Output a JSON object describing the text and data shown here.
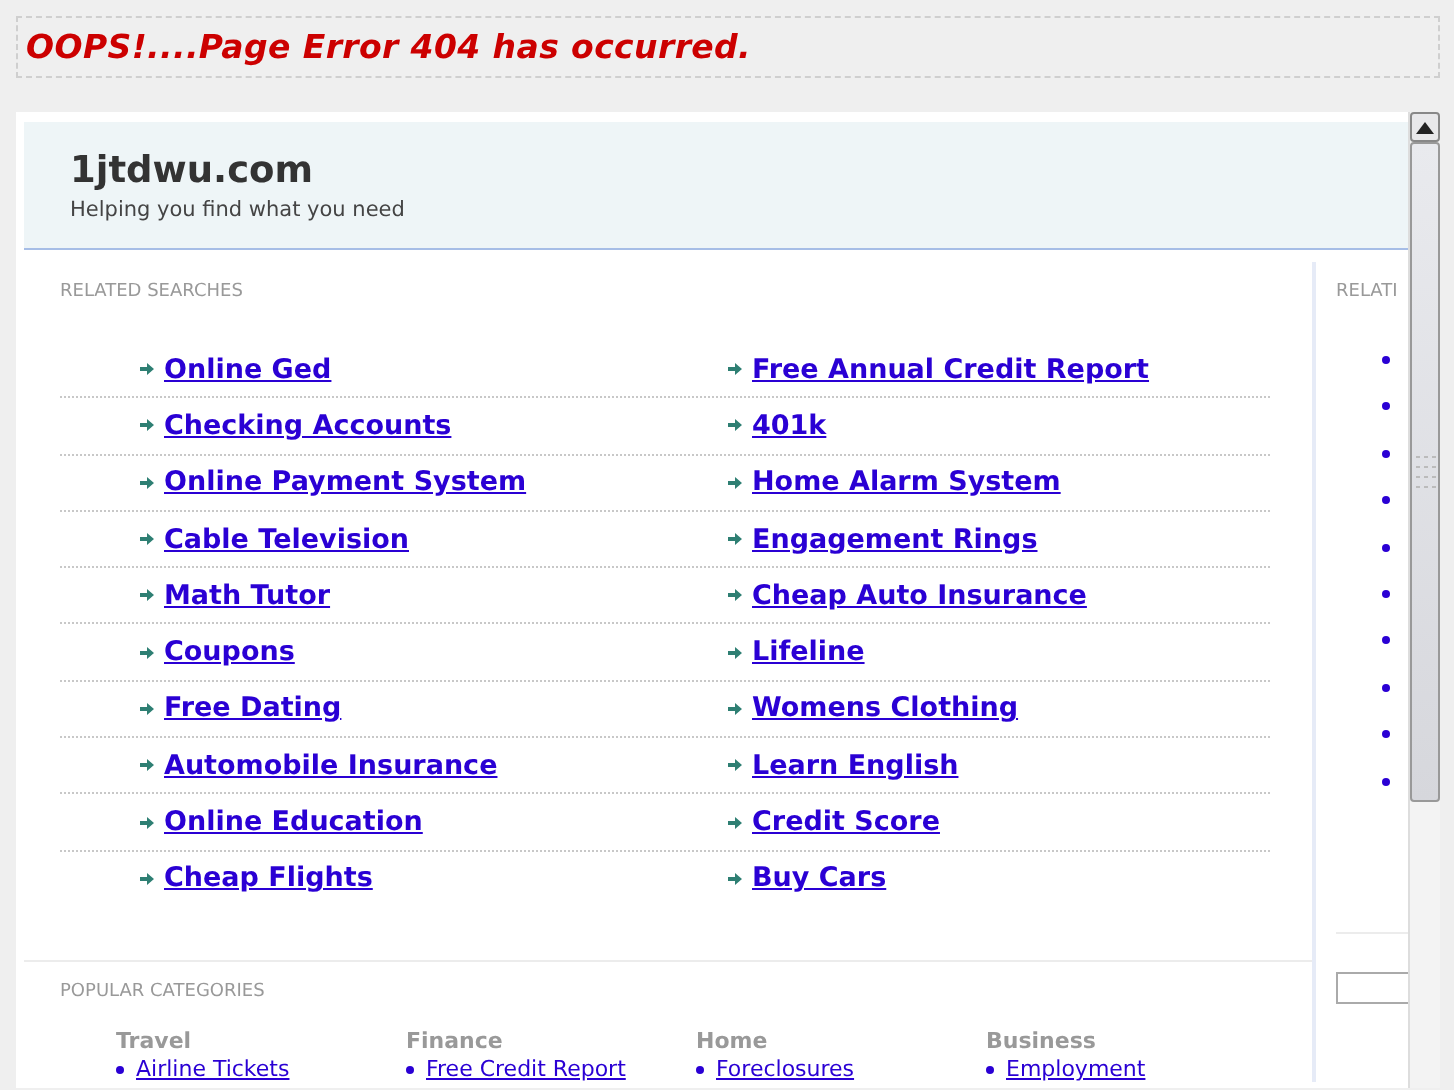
{
  "error_banner": {
    "text": "OOPS!....Page Error 404 has occurred."
  },
  "header": {
    "site": "1jtdwu.com",
    "tagline": "Helping you find what you need"
  },
  "related_searches": {
    "label": "RELATED SEARCHES",
    "rows": [
      [
        "Online Ged",
        "Free Annual Credit Report"
      ],
      [
        "Checking Accounts",
        "401k"
      ],
      [
        "Online Payment System",
        "Home Alarm System"
      ],
      [
        "Cable Television",
        "Engagement Rings"
      ],
      [
        "Math Tutor",
        "Cheap Auto Insurance"
      ],
      [
        "Coupons",
        "Lifeline"
      ],
      [
        "Free Dating",
        "Womens Clothing"
      ],
      [
        "Automobile Insurance",
        "Learn English"
      ],
      [
        "Online Education",
        "Credit Score"
      ],
      [
        "Cheap Flights",
        "Buy Cars"
      ]
    ]
  },
  "popular_categories": {
    "label": "POPULAR CATEGORIES",
    "categories": [
      {
        "heading": "Travel",
        "links": [
          "Airline Tickets"
        ]
      },
      {
        "heading": "Finance",
        "links": [
          "Free Credit Report"
        ]
      },
      {
        "heading": "Home",
        "links": [
          "Foreclosures"
        ]
      },
      {
        "heading": "Business",
        "links": [
          "Employment"
        ]
      }
    ]
  },
  "sidebar": {
    "label": "RELATI"
  }
}
